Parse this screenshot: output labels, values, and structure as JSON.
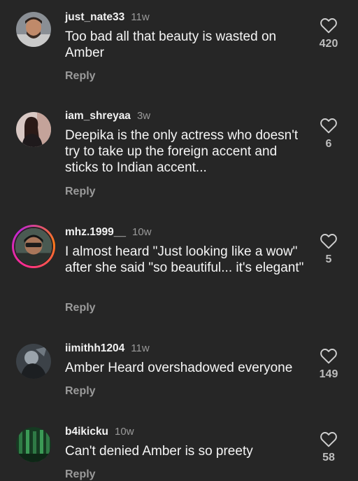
{
  "comments": [
    {
      "username": "just_nate33",
      "age": "11w",
      "text": "Too bad all that beauty is wasted on Amber",
      "reply": "Reply",
      "likes": "420",
      "avatar_icon": "user-photo"
    },
    {
      "username": "iam_shreyaa",
      "age": "3w",
      "text": "Deepika is the only actress who doesn't try to take up the foreign accent and sticks to Indian accent...",
      "reply": "Reply",
      "likes": "6",
      "avatar_icon": "user-photo"
    },
    {
      "username": "mhz.1999__",
      "age": "10w",
      "text": "I almost heard \"Just looking like a wow\" after she said \"so beautiful... it's elegant\"",
      "reply": "Reply",
      "likes": "5",
      "avatar_icon": "user-photo-story-ring"
    },
    {
      "username": "iimithh1204",
      "age": "11w",
      "text": "Amber Heard overshadowed everyone",
      "reply": "Reply",
      "likes": "149",
      "avatar_icon": "user-photo"
    },
    {
      "username": "b4ikicku",
      "age": "10w",
      "text": "Can't denied Amber is so preety",
      "reply": "Reply",
      "likes": "58",
      "avatar_icon": "user-photo"
    }
  ],
  "colors": {
    "background": "#262626",
    "secondary_text": "#9a9a9a",
    "story_ring": "#ff2d8a"
  }
}
